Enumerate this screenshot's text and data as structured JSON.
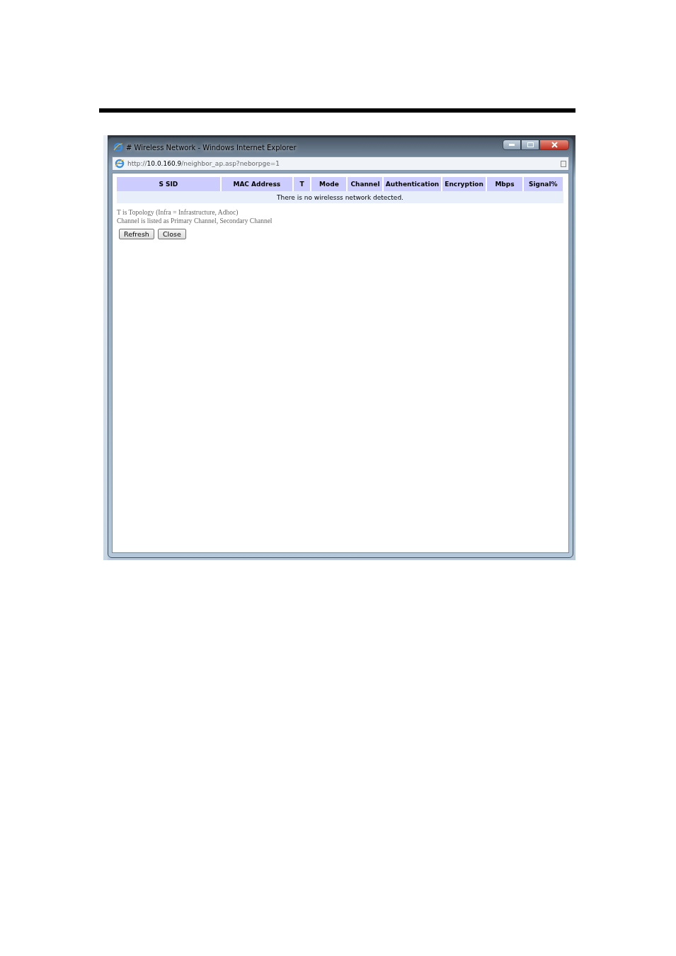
{
  "window": {
    "title": "# Wireless Network - Windows Internet Explorer",
    "address": {
      "prefix": "http://",
      "host": "10.0.160.9",
      "path": "/neighbor_ap.asp?neborpge=1"
    }
  },
  "table": {
    "columns": [
      "S SID",
      "MAC Address",
      "T",
      "Mode",
      "Channel",
      "Authentication",
      "Encryption",
      "Mbps",
      "Signal%"
    ],
    "empty_message": "There is no wirelesss network detected."
  },
  "notes": [
    "T is Topology (Infra = Infrastructure, Adhoc)",
    "Channel is listed as Primary Channel, Secondary Channel"
  ],
  "buttons": [
    "Refresh",
    "Close"
  ]
}
